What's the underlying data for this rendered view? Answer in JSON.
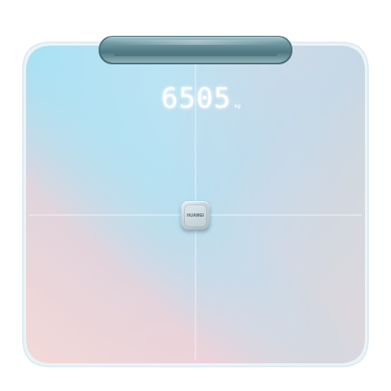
{
  "scale": {
    "weight_reading": "6505",
    "unit_label": "kg",
    "brand_label": "HUAWEI",
    "colors": {
      "blue": "#a6e1f3",
      "pink": "#f8d3d3",
      "handle": "#5f8893",
      "display_glow": "#ffffff"
    }
  }
}
